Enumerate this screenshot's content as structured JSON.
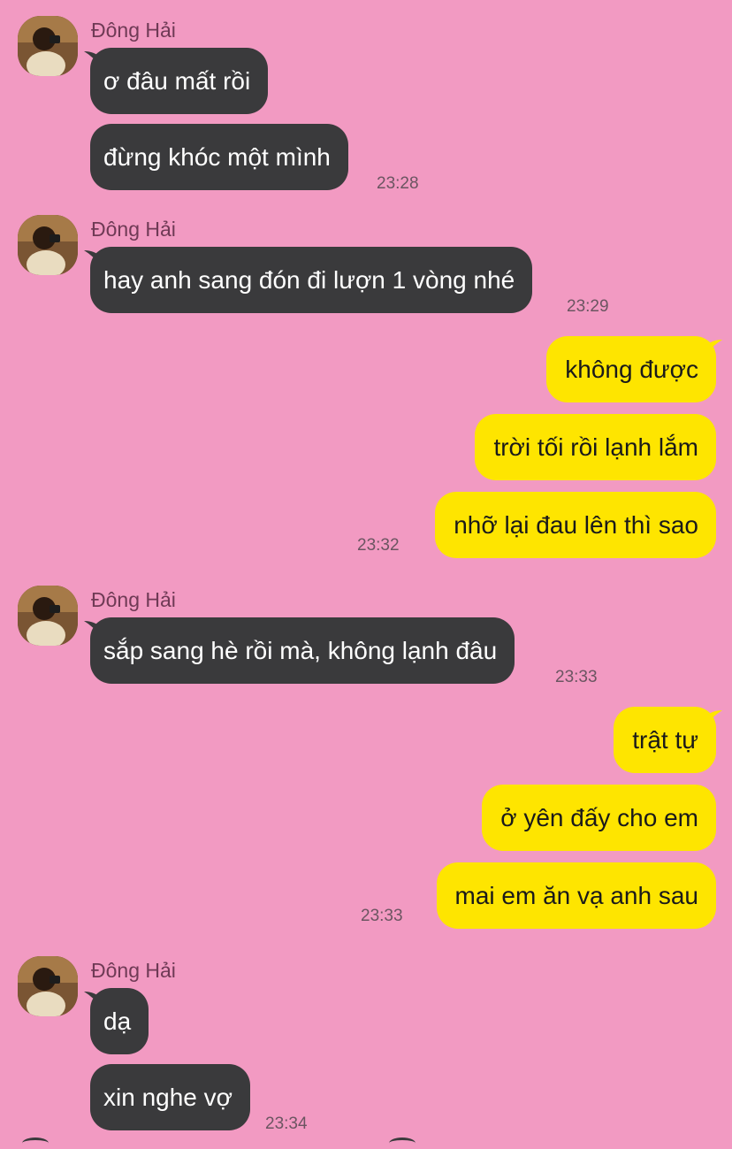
{
  "colors": {
    "background": "#F29AC2",
    "incoming_bubble": "#3A3A3C",
    "outgoing_bubble": "#FEE500"
  },
  "messages": [
    {
      "direction": "in",
      "sender": "Đông Hải",
      "bubbles": [
        "ơ đâu mất rồi",
        "đừng khóc một mình"
      ],
      "time": "23:28"
    },
    {
      "direction": "in",
      "sender": "Đông Hải",
      "bubbles": [
        "hay anh sang đón đi lượn 1 vòng nhé"
      ],
      "time": "23:29"
    },
    {
      "direction": "out",
      "bubbles": [
        "không được",
        "trời tối rồi lạnh lắm",
        "nhỡ lại đau lên thì sao"
      ],
      "time": "23:32"
    },
    {
      "direction": "in",
      "sender": "Đông Hải",
      "bubbles": [
        "sắp sang hè rồi mà, không lạnh đâu"
      ],
      "time": "23:33"
    },
    {
      "direction": "out",
      "bubbles": [
        "trật tự",
        "ở yên đấy cho em",
        "mai em ăn vạ anh sau"
      ],
      "time": "23:33"
    },
    {
      "direction": "in",
      "sender": "Đông Hải",
      "bubbles": [
        "dạ",
        "xin nghe vợ"
      ],
      "time": "23:34"
    }
  ]
}
